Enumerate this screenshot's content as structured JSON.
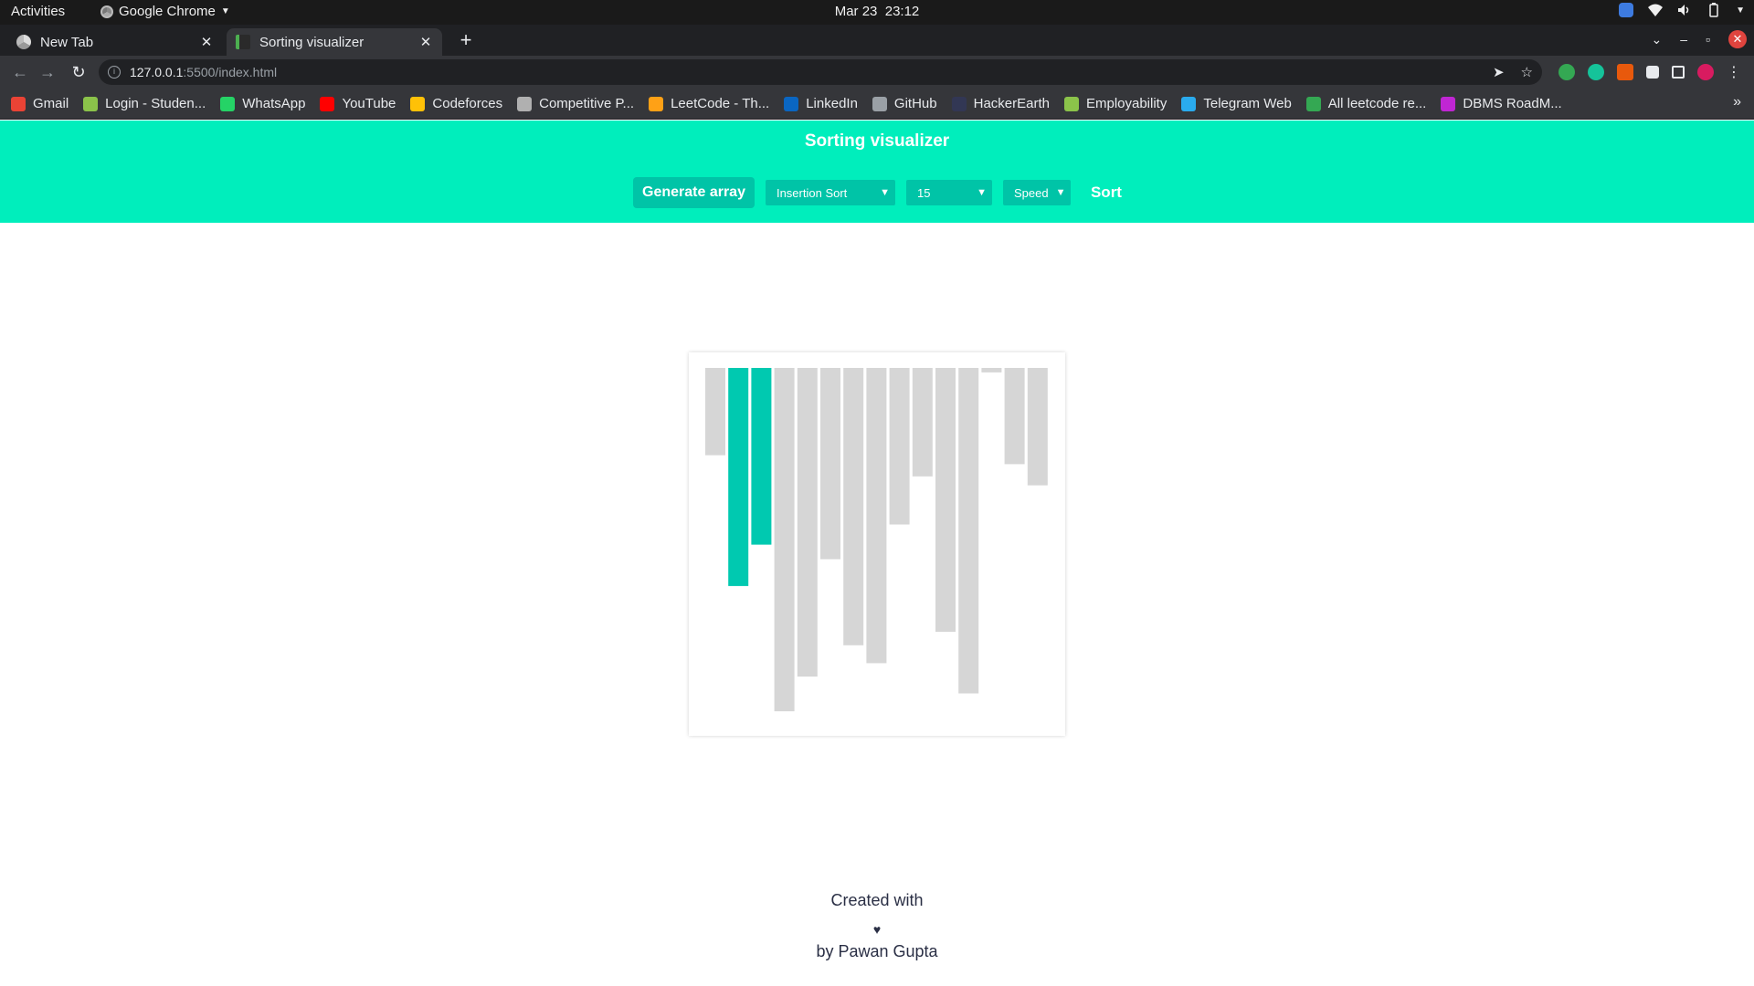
{
  "system_bar": {
    "activities": "Activities",
    "app_name": "Google Chrome",
    "date": "Mar 23",
    "time": "23:12"
  },
  "tabs": [
    {
      "title": "New Tab",
      "close": "✕"
    },
    {
      "title": "Sorting visualizer",
      "close": "✕"
    }
  ],
  "new_tab_symbol": "+",
  "address_bar": {
    "host": "127.0.0.1",
    "path": ":5500/index.html"
  },
  "bookmarks": [
    {
      "label": "Gmail",
      "color": "#ea4335"
    },
    {
      "label": "Login - Studen...",
      "color": "#8bc34a"
    },
    {
      "label": "WhatsApp",
      "color": "#25d366"
    },
    {
      "label": "YouTube",
      "color": "#ff0000"
    },
    {
      "label": "Codeforces",
      "color": "#ffc107"
    },
    {
      "label": "Competitive P...",
      "color": "#b0b0b0"
    },
    {
      "label": "LeetCode - Th...",
      "color": "#ffa116"
    },
    {
      "label": "LinkedIn",
      "color": "#0a66c2"
    },
    {
      "label": "GitHub",
      "color": "#9aa0a6"
    },
    {
      "label": "HackerEarth",
      "color": "#323754"
    },
    {
      "label": "Employability",
      "color": "#8bc34a"
    },
    {
      "label": "Telegram Web",
      "color": "#2aabee"
    },
    {
      "label": "All leetcode re...",
      "color": "#34a853"
    },
    {
      "label": "DBMS RoadM...",
      "color": "#c026d3"
    }
  ],
  "app": {
    "title": "Sorting visualizer",
    "generate_label": "Generate array",
    "algorithm_selected": "Insertion Sort",
    "size_selected": "15",
    "speed_selected": "Speed",
    "sort_label": "Sort",
    "accent": "#00eebc",
    "button_color": "#00c4a7"
  },
  "chart_data": {
    "type": "bar",
    "orientation": "hanging from top",
    "values": [
      78,
      195,
      158,
      307,
      276,
      171,
      248,
      264,
      140,
      97,
      236,
      291,
      4,
      86,
      105
    ],
    "highlighted_indices": [
      1,
      2
    ],
    "bar_color": "#d6d6d6",
    "highlight_color": "#00c9b0",
    "ylim": [
      0,
      320
    ]
  },
  "footer": {
    "created_with": "Created with",
    "heart": "♥",
    "by": "by Pawan Gupta"
  }
}
